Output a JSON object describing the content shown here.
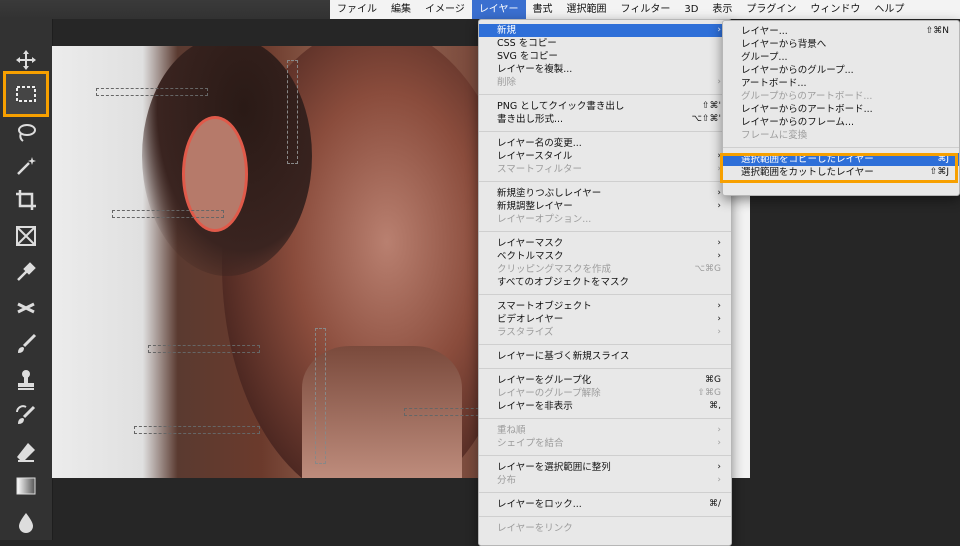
{
  "menubar": {
    "items": [
      "ファイル",
      "編集",
      "イメージ",
      "レイヤー",
      "書式",
      "選択範囲",
      "フィルター",
      "3D",
      "表示",
      "プラグイン",
      "ウィンドウ",
      "ヘルプ"
    ],
    "active_index": 3
  },
  "toolbar": {
    "top_icons": [
      "close-icon",
      "collapse-icon"
    ],
    "tools": [
      "move-tool",
      "rectangular-marquee-tool",
      "lasso-tool",
      "magic-wand-tool",
      "crop-tool",
      "frame-tool",
      "eyedropper-tool",
      "healing-brush-tool",
      "brush-tool",
      "clone-stamp-tool",
      "history-brush-tool",
      "eraser-tool",
      "gradient-tool",
      "blur-tool"
    ],
    "selected_tool": "rectangular-marquee-tool"
  },
  "layer_menu": {
    "rows": [
      {
        "label": "新規",
        "shortcut": "›",
        "disabled": false,
        "highlight": true
      },
      {
        "label": "CSS をコピー",
        "shortcut": "",
        "disabled": false
      },
      {
        "label": "SVG をコピー",
        "shortcut": "",
        "disabled": false
      },
      {
        "label": "レイヤーを複製...",
        "shortcut": "",
        "disabled": false
      },
      {
        "label": "削除",
        "shortcut": "›",
        "disabled": true
      },
      {
        "sep": true
      },
      {
        "label": "PNG としてクイック書き出し",
        "shortcut": "⇧⌘'",
        "disabled": false
      },
      {
        "label": "書き出し形式...",
        "shortcut": "⌥⇧⌘'",
        "disabled": false
      },
      {
        "sep": true
      },
      {
        "label": "レイヤー名の変更...",
        "shortcut": "",
        "disabled": false
      },
      {
        "label": "レイヤースタイル",
        "shortcut": "›",
        "disabled": false
      },
      {
        "label": "スマートフィルター",
        "shortcut": "›",
        "disabled": true
      },
      {
        "sep": true
      },
      {
        "label": "新規塗りつぶしレイヤー",
        "shortcut": "›",
        "disabled": false
      },
      {
        "label": "新規調整レイヤー",
        "shortcut": "›",
        "disabled": false
      },
      {
        "label": "レイヤーオプション...",
        "shortcut": "",
        "disabled": true
      },
      {
        "sep": true
      },
      {
        "label": "レイヤーマスク",
        "shortcut": "›",
        "disabled": false
      },
      {
        "label": "ベクトルマスク",
        "shortcut": "›",
        "disabled": false
      },
      {
        "label": "クリッピングマスクを作成",
        "shortcut": "⌥⌘G",
        "disabled": true
      },
      {
        "label": "すべてのオブジェクトをマスク",
        "shortcut": "",
        "disabled": false
      },
      {
        "sep": true
      },
      {
        "label": "スマートオブジェクト",
        "shortcut": "›",
        "disabled": false
      },
      {
        "label": "ビデオレイヤー",
        "shortcut": "›",
        "disabled": false
      },
      {
        "label": "ラスタライズ",
        "shortcut": "›",
        "disabled": true
      },
      {
        "sep": true
      },
      {
        "label": "レイヤーに基づく新規スライス",
        "shortcut": "",
        "disabled": false
      },
      {
        "sep": true
      },
      {
        "label": "レイヤーをグループ化",
        "shortcut": "⌘G",
        "disabled": false
      },
      {
        "label": "レイヤーのグループ解除",
        "shortcut": "⇧⌘G",
        "disabled": true
      },
      {
        "label": "レイヤーを非表示",
        "shortcut": "⌘,",
        "disabled": false
      },
      {
        "sep": true
      },
      {
        "label": "重ね順",
        "shortcut": "›",
        "disabled": true
      },
      {
        "label": "シェイプを結合",
        "shortcut": "›",
        "disabled": true
      },
      {
        "sep": true
      },
      {
        "label": "レイヤーを選択範囲に整列",
        "shortcut": "›",
        "disabled": false
      },
      {
        "label": "分布",
        "shortcut": "›",
        "disabled": true
      },
      {
        "sep": true
      },
      {
        "label": "レイヤーをロック...",
        "shortcut": "⌘/",
        "disabled": false
      },
      {
        "sep": true
      },
      {
        "label": "レイヤーをリンク",
        "shortcut": "",
        "disabled": true
      }
    ]
  },
  "new_submenu": {
    "rows": [
      {
        "label": "レイヤー...",
        "shortcut": "⇧⌘N",
        "disabled": false
      },
      {
        "label": "レイヤーから背景へ",
        "shortcut": "",
        "disabled": false
      },
      {
        "label": "グループ...",
        "shortcut": "",
        "disabled": false
      },
      {
        "label": "レイヤーからのグループ...",
        "shortcut": "",
        "disabled": false
      },
      {
        "label": "アートボード...",
        "shortcut": "",
        "disabled": false
      },
      {
        "label": "グループからのアートボード...",
        "shortcut": "",
        "disabled": true
      },
      {
        "label": "レイヤーからのアートボード...",
        "shortcut": "",
        "disabled": false
      },
      {
        "label": "レイヤーからのフレーム...",
        "shortcut": "",
        "disabled": false
      },
      {
        "label": "フレームに変換",
        "shortcut": "",
        "disabled": true
      },
      {
        "sep": true
      },
      {
        "label": "選択範囲をコピーしたレイヤー",
        "shortcut": "⌘J",
        "disabled": false,
        "highlight": true
      },
      {
        "label": "選択範囲をカットしたレイヤー",
        "shortcut": "⇧⌘J",
        "disabled": false
      }
    ]
  },
  "colors": {
    "accent_orange": "#f7a000",
    "menu_highlight": "#2e6fd8"
  }
}
